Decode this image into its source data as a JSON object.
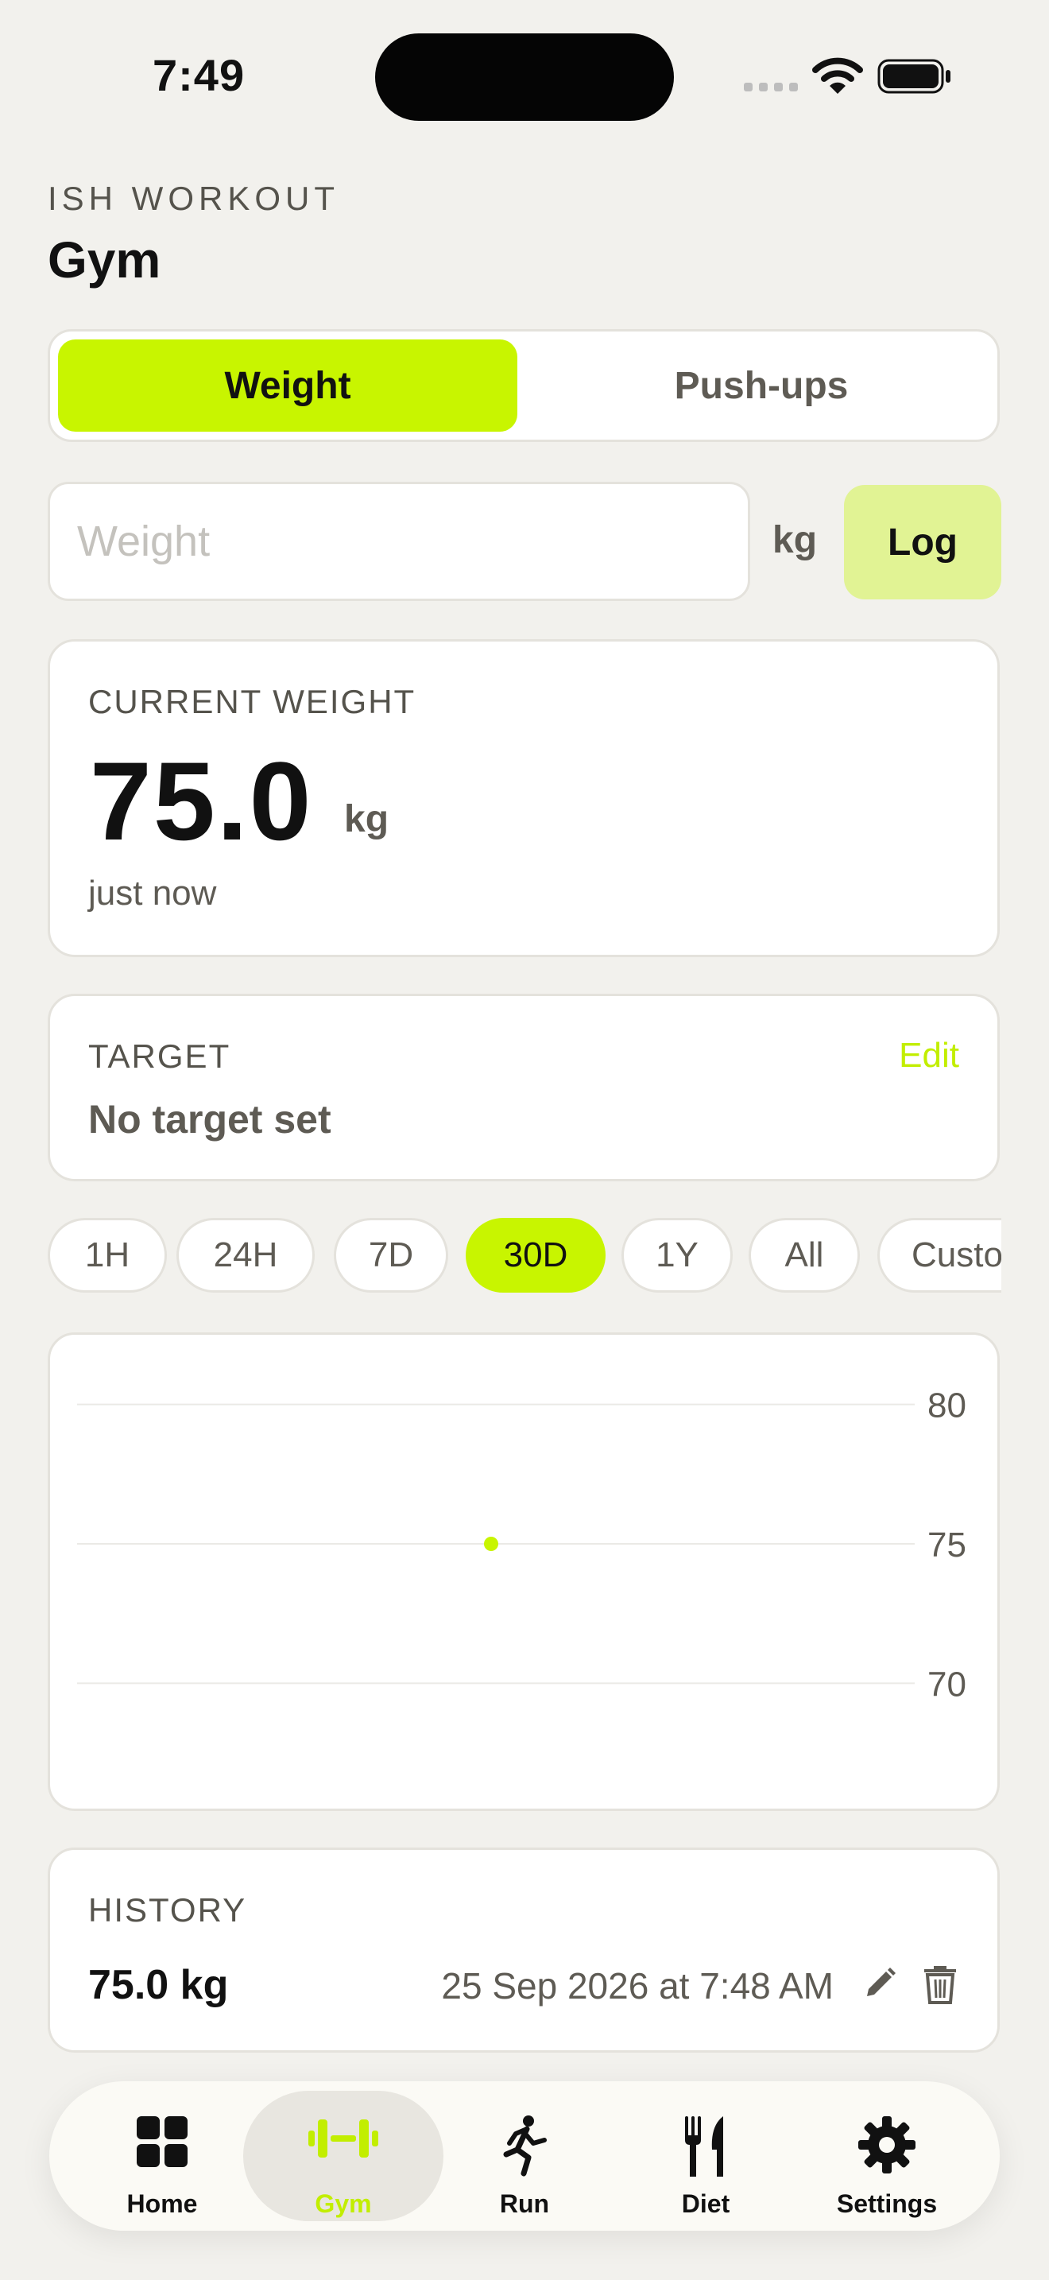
{
  "status": {
    "time": "7:49"
  },
  "header": {
    "eyebrow": "ISH WORKOUT",
    "title": "Gym"
  },
  "segments": [
    {
      "label": "Weight",
      "active": true
    },
    {
      "label": "Push-ups",
      "active": false
    }
  ],
  "entry": {
    "placeholder": "Weight",
    "value": "",
    "unit": "kg",
    "log_label": "Log"
  },
  "current": {
    "label": "CURRENT WEIGHT",
    "value": "75.0",
    "unit": "kg",
    "time": "just now"
  },
  "target": {
    "label": "TARGET",
    "edit_label": "Edit",
    "text": "No target set"
  },
  "ranges": [
    {
      "label": "1H",
      "active": false
    },
    {
      "label": "24H",
      "active": false
    },
    {
      "label": "7D",
      "active": false
    },
    {
      "label": "30D",
      "active": true
    },
    {
      "label": "1Y",
      "active": false
    },
    {
      "label": "All",
      "active": false
    },
    {
      "label": "Custom",
      "active": false
    }
  ],
  "chart_data": {
    "type": "scatter",
    "x": [
      "2026-09-25"
    ],
    "y": [
      75.0
    ],
    "yticks": [
      80,
      75,
      70
    ],
    "ylim": [
      67.5,
      82.5
    ],
    "y_axis_side": "right",
    "grid": true,
    "point_color": "#c8f500"
  },
  "history": {
    "label": "HISTORY",
    "entries": [
      {
        "value": "75.0 kg",
        "date": "25 Sep 2026 at 7:48 AM"
      }
    ]
  },
  "tabs": [
    {
      "label": "Home",
      "icon": "grid-icon",
      "active": false
    },
    {
      "label": "Gym",
      "icon": "dumbbell-icon",
      "active": true
    },
    {
      "label": "Run",
      "icon": "runner-icon",
      "active": false
    },
    {
      "label": "Diet",
      "icon": "fork-knife-icon",
      "active": false
    },
    {
      "label": "Settings",
      "icon": "gear-icon",
      "active": false
    }
  ],
  "colors": {
    "accent": "#c8f500",
    "accent_soft": "#e1f394",
    "background": "#f2f1ed"
  }
}
